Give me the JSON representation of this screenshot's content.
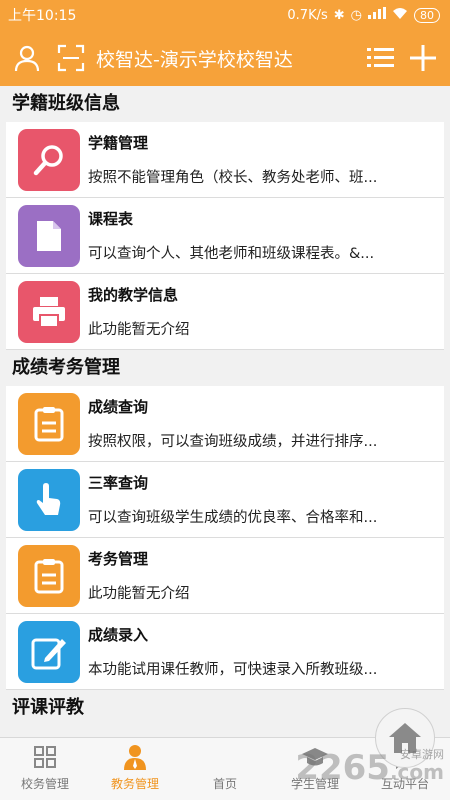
{
  "status": {
    "time": "上午10:15",
    "speed": "0.7K/s",
    "battery": "80"
  },
  "header": {
    "title": "校智达-演示学校校智达"
  },
  "sections": [
    {
      "title": "学籍班级信息",
      "items": [
        {
          "title": "学籍管理",
          "desc": "按照不能管理角色（校长、教务处老师、班...",
          "icon": "search-icon",
          "color": "#e8566b"
        },
        {
          "title": "课程表",
          "desc": "可以查询个人、其他老师和班级课程表。&...",
          "icon": "document-icon",
          "color": "#9b6fc4"
        },
        {
          "title": "我的教学信息",
          "desc": "此功能暂无介绍",
          "icon": "printer-icon",
          "color": "#e8566b"
        }
      ]
    },
    {
      "title": "成绩考务管理",
      "items": [
        {
          "title": "成绩查询",
          "desc": "按照权限，可以查询班级成绩，并进行排序...",
          "icon": "clipboard-icon",
          "color": "#f39b2e"
        },
        {
          "title": "三率查询",
          "desc": "可以查询班级学生成绩的优良率、合格率和...",
          "icon": "touch-icon",
          "color": "#2a9fe0"
        },
        {
          "title": "考务管理",
          "desc": "此功能暂无介绍",
          "icon": "clipboard-icon",
          "color": "#f39b2e"
        },
        {
          "title": "成绩录入",
          "desc": "本功能试用课任教师，可快速录入所教班级...",
          "icon": "edit-icon",
          "color": "#2a9fe0"
        }
      ]
    },
    {
      "title": "评课评教",
      "items": []
    }
  ],
  "tabs": [
    {
      "label": "校务管理",
      "icon": "grid-icon",
      "active": false
    },
    {
      "label": "教务管理",
      "icon": "teacher-icon",
      "active": true
    },
    {
      "label": "首页",
      "icon": "home-icon",
      "active": false
    },
    {
      "label": "学生管理",
      "icon": "graduation-cap-icon",
      "active": false
    },
    {
      "label": "互动平台",
      "icon": "chat-icon",
      "active": false
    }
  ],
  "watermark": {
    "main": "2265",
    "sub": "安卓游网",
    "suffix": ".com"
  }
}
